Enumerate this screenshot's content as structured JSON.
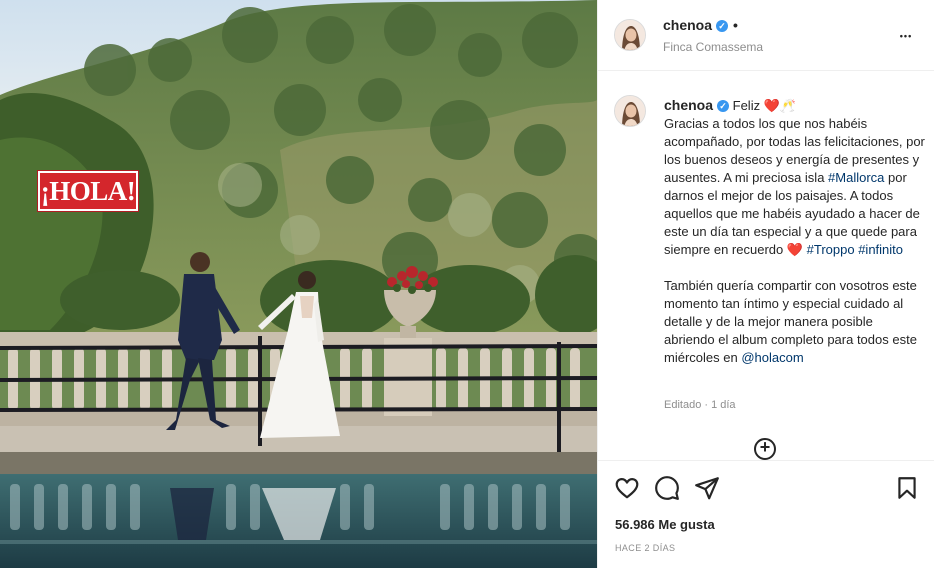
{
  "post": {
    "username": "chenoa",
    "verified_icon": "verified-badge-icon",
    "header_dot": "•",
    "location": "Finca Comassema",
    "more_glyph": "•••",
    "photo_logo": "¡HOLA!"
  },
  "caption": {
    "username": "chenoa",
    "opening": "Feliz ❤️🥂",
    "para1_a": "Gracias a todos los que nos habéis acompañado, por todas las felicitaciones, por los buenos deseos y energía de presentes y ausentes. A mi preciosa isla ",
    "tag_mallorca": "#Mallorca",
    "para1_b": " por darnos el mejor de los paisajes. A todos aquellos que me habéis ayudado a hacer de este un día tan especial y a que quede para siempre en recuerdo ❤️ ",
    "tag_troppo": "#Troppo",
    "space": " ",
    "tag_infinito": "#infinito",
    "para2_a": "También quería compartir con vosotros este momento tan íntimo y especial cuidado al detalle y de la mejor manera posible abriendo el album completo para todos este miércoles en ",
    "mention_holacom": "@holacom",
    "edited": "Editado · 1 día"
  },
  "actions": {
    "icons": [
      "heart-icon",
      "comment-icon",
      "share-icon",
      "save-icon",
      "add-comment-icon"
    ],
    "likes": "56.986 Me gusta",
    "time_ago": "HACE 2 DÍAS"
  },
  "colors": {
    "link": "#00376b",
    "muted": "#8e8e8e",
    "verified": "#3897f0",
    "hola_red": "#d4262c"
  }
}
